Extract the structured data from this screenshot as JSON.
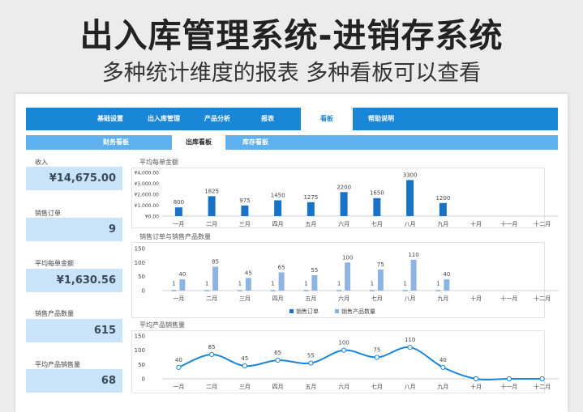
{
  "hero": {
    "title": "出入库管理系统-进销存系统",
    "subtitle": "多种统计维度的报表 多种看板可以查看"
  },
  "nav": {
    "items": [
      "基础设置",
      "出入库管理",
      "产品分析",
      "报表",
      "看板",
      "帮助说明"
    ],
    "active_index": 4
  },
  "subnav": {
    "items": [
      "财务看板",
      "出库看板",
      "库存看板"
    ],
    "active_index": 1
  },
  "kpis": [
    {
      "label": "收入",
      "value": "¥14,675.00"
    },
    {
      "label": "销售订单",
      "value": "9"
    },
    {
      "label": "平均每单金额",
      "value": "¥1,630.56"
    },
    {
      "label": "销售产品数量",
      "value": "615"
    },
    {
      "label": "平均产品销售量",
      "value": "68"
    }
  ],
  "colors": {
    "nav_bg": "#1a86d8",
    "subnav_bg": "#5fb0ee",
    "kpi_bg": "#c9e3f8",
    "bar_dark": "#1a72c6",
    "bar_light": "#8eb4e3",
    "line": "#1a86d8"
  },
  "chart_data": [
    {
      "type": "bar",
      "title": "平均每单金额",
      "categories": [
        "一月",
        "二月",
        "三月",
        "四月",
        "五月",
        "六月",
        "七月",
        "八月",
        "九月",
        "十月",
        "十一月",
        "十二月"
      ],
      "values": [
        800,
        1825,
        975,
        1450,
        1275,
        2200,
        1650,
        3300,
        1200,
        null,
        null,
        null
      ],
      "data_labels": [
        "800",
        "1825",
        "975",
        "1450",
        "1275",
        "2200",
        "1650",
        "3300",
        "1200",
        "",
        "",
        ""
      ],
      "yticks": [
        "¥0.00",
        "¥1,000.00",
        "¥2,000.00",
        "¥3,000.00",
        "¥4,000.00"
      ],
      "ylim": [
        0,
        4000
      ]
    },
    {
      "type": "bar",
      "title": "销售订单与销售产品数量",
      "categories": [
        "一月",
        "二月",
        "三月",
        "四月",
        "五月",
        "六月",
        "七月",
        "八月",
        "九月",
        "十月",
        "十一月",
        "十二月"
      ],
      "series": [
        {
          "name": "销售订单",
          "values": [
            1,
            1,
            1,
            1,
            1,
            1,
            1,
            1,
            1,
            null,
            null,
            null
          ]
        },
        {
          "name": "销售产品数量",
          "values": [
            40,
            85,
            45,
            65,
            55,
            100,
            75,
            110,
            40,
            null,
            null,
            null
          ]
        }
      ],
      "yticks": [
        "0",
        "50",
        "100",
        "150"
      ],
      "ylim": [
        0,
        150
      ],
      "legend": "bottom"
    },
    {
      "type": "line",
      "title": "平均产品销售量",
      "categories": [
        "一月",
        "二月",
        "三月",
        "四月",
        "五月",
        "六月",
        "七月",
        "八月",
        "九月",
        "十月",
        "十一月",
        "十二月"
      ],
      "values": [
        40,
        85,
        45,
        65,
        55,
        100,
        75,
        110,
        40,
        0,
        0,
        0
      ],
      "data_labels": [
        "40",
        "85",
        "45",
        "65",
        "55",
        "100",
        "75",
        "110",
        "40",
        "",
        "",
        ""
      ],
      "yticks": [
        "0",
        "50",
        "100",
        "150"
      ],
      "ylim": [
        0,
        150
      ]
    }
  ]
}
